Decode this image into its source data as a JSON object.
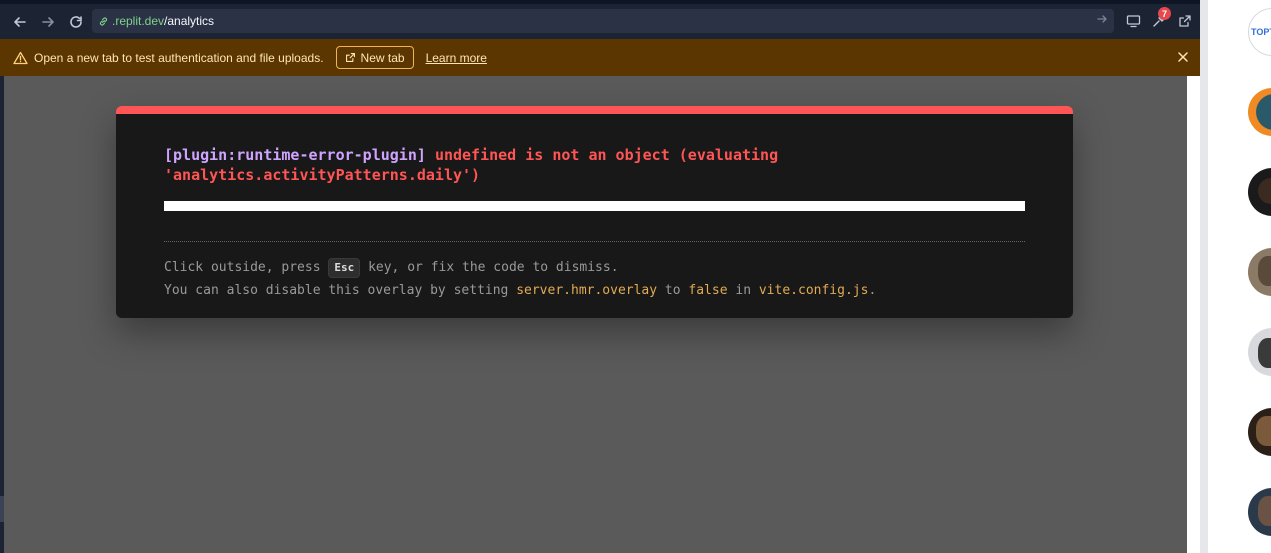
{
  "browser": {
    "url_domain": ".replit.dev",
    "url_path": "/analytics",
    "extensions_badge": "7",
    "icons": [
      "arrow-left-icon",
      "arrow-right-icon",
      "reload-icon",
      "link-icon",
      "arrow-go-icon",
      "monitor-icon",
      "wrench-icon",
      "external-link-icon"
    ]
  },
  "banner": {
    "message": "Open a new tab to test authentication and file uploads.",
    "new_tab_label": "New tab",
    "learn_more_label": "Learn more",
    "icons": [
      "warning-icon",
      "external-link-icon",
      "close-icon"
    ]
  },
  "error_overlay": {
    "plugin": "[plugin:runtime-error-plugin]",
    "message": "undefined is not an object (evaluating 'analytics.activityPatterns.daily')",
    "tip_line1_a": "Click outside, press",
    "tip_key": "Esc",
    "tip_line1_b": "key, or fix the code to dismiss.",
    "tip_line2_a": "You can also disable this overlay by setting",
    "tip_setting": "server.hmr.overlay",
    "tip_to": "to",
    "tip_false": "false",
    "tip_in": "in",
    "tip_file": "vite.config.js",
    "tip_period": ".",
    "colors": {
      "accent": "#ff5555",
      "plugin": "#cfa4ff",
      "code": "#e2aa53"
    }
  },
  "side_panel": {
    "logo_text": "TOPT",
    "avatar_colors": [
      "#f08a24",
      "#1a1a1a",
      "#8a7a66",
      "#3a3a3a",
      "#2a2018",
      "#2a3a4a"
    ]
  }
}
